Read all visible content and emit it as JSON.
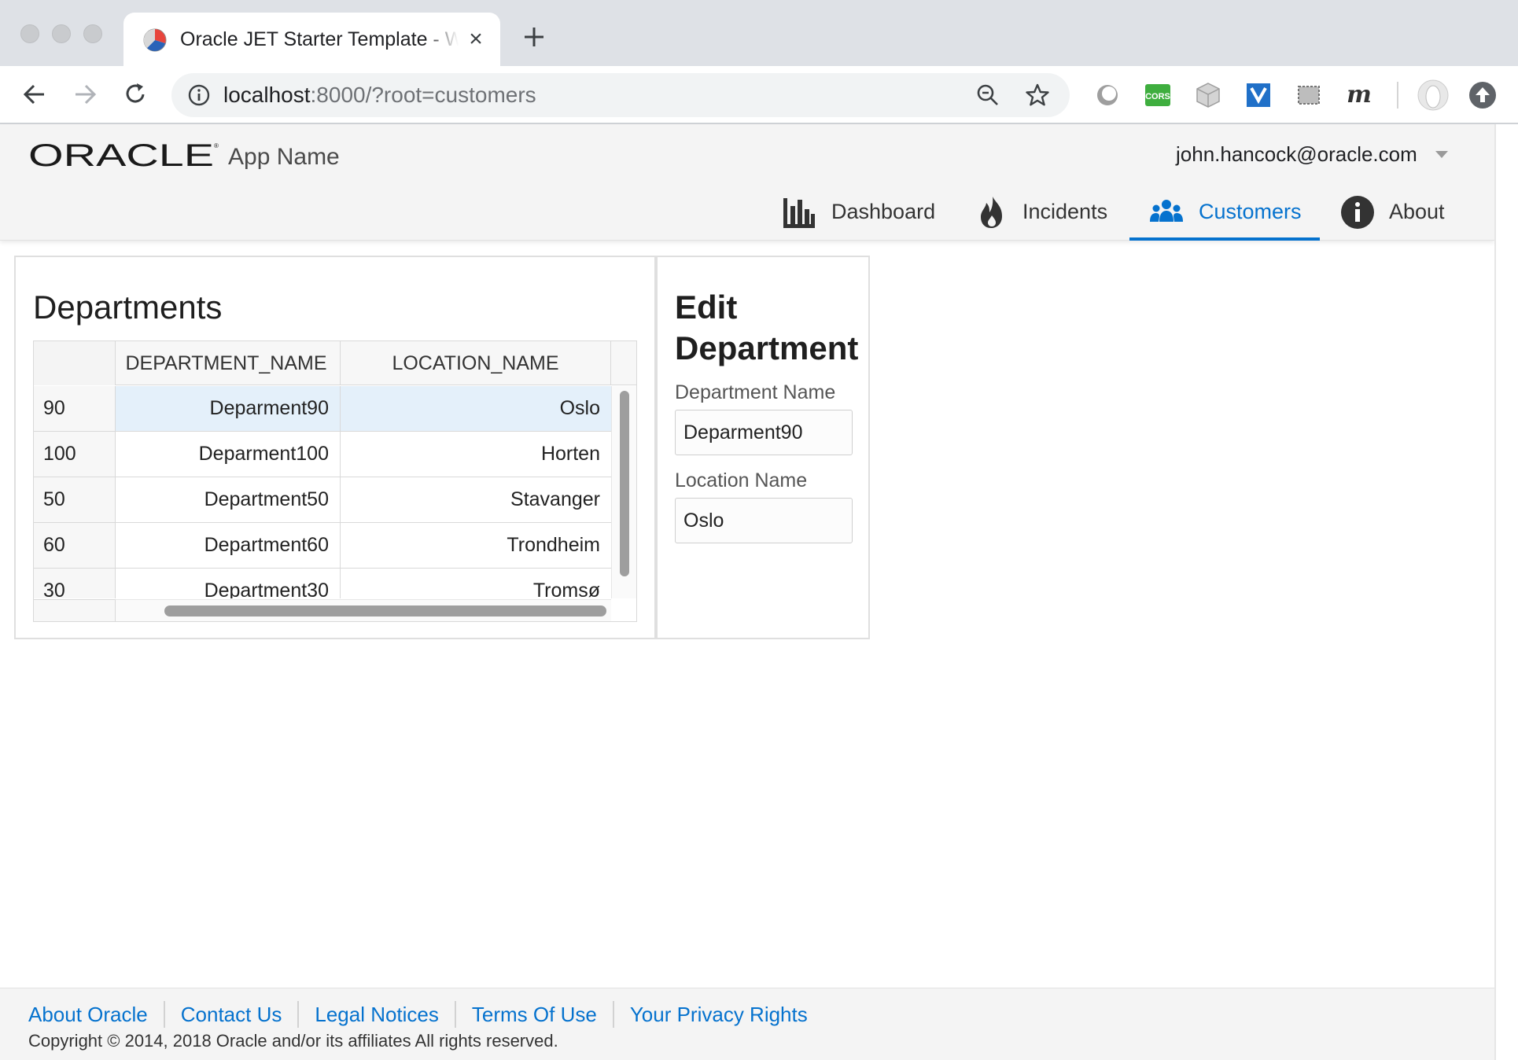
{
  "browser": {
    "tab": {
      "title": "Oracle JET Starter Template - Web Nav Bar"
    },
    "address_bar": {
      "host": "localhost",
      "rest": ":8000/?root=customers"
    },
    "extensions": [
      "circle-extension-icon",
      "cors-extension-icon",
      "cube-extension-icon",
      "shield-extension-icon",
      "screenshot-extension-icon",
      "m-extension-icon"
    ]
  },
  "app": {
    "brand": "ORACLE",
    "app_name": "App Name",
    "user": "john.hancock@oracle.com",
    "nav": [
      {
        "label": "Dashboard",
        "icon": "bar-chart-icon",
        "active": false
      },
      {
        "label": "Incidents",
        "icon": "flame-icon",
        "active": false
      },
      {
        "label": "Customers",
        "icon": "people-icon",
        "active": true
      },
      {
        "label": "About",
        "icon": "info-icon",
        "active": false
      }
    ],
    "accent_color": "#0572ce"
  },
  "departments": {
    "title": "Departments",
    "columns": [
      "DEPARTMENT_NAME",
      "LOCATION_NAME"
    ],
    "rows": [
      {
        "id": "90",
        "department_name": "Deparment90",
        "location_name": "Oslo",
        "selected": true
      },
      {
        "id": "100",
        "department_name": "Deparment100",
        "location_name": "Horten",
        "selected": false
      },
      {
        "id": "50",
        "department_name": "Department50",
        "location_name": "Stavanger",
        "selected": false
      },
      {
        "id": "60",
        "department_name": "Department60",
        "location_name": "Trondheim",
        "selected": false
      },
      {
        "id": "30",
        "department_name": "Department30",
        "location_name": "Tromsø",
        "selected": false
      }
    ]
  },
  "edit": {
    "title": "Edit Department",
    "department_name_label": "Department Name",
    "department_name_value": "Deparment90",
    "location_name_label": "Location Name",
    "location_name_value": "Oslo"
  },
  "footer": {
    "links": [
      "About Oracle",
      "Contact Us",
      "Legal Notices",
      "Terms Of Use",
      "Your Privacy Rights"
    ],
    "copyright": "Copyright © 2014, 2018 Oracle and/or its affiliates All rights reserved."
  }
}
